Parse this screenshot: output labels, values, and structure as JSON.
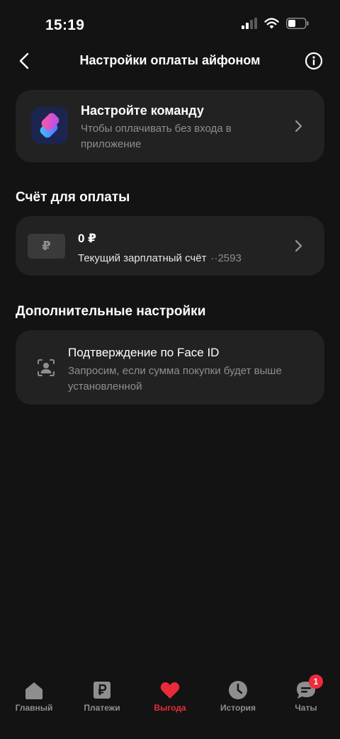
{
  "status_bar": {
    "time": "15:19"
  },
  "header": {
    "title": "Настройки оплаты айфоном"
  },
  "shortcut_card": {
    "title": "Настройте команду",
    "description": "Чтобы оплачивать без входа в приложение"
  },
  "account_section": {
    "title": "Счёт для оплаты",
    "balance": "0 ₽",
    "account_name": "Текущий зарплатный счёт",
    "account_number": "··2593",
    "badge_symbol": "₽"
  },
  "extra_section": {
    "title": "Дополнительные настройки",
    "faceid_title": "Подтверждение по Face ID",
    "faceid_description": "Запросим, если сумма покупки будет выше установленной"
  },
  "tab_bar": {
    "tabs": [
      {
        "label": "Главный",
        "icon": "home-icon"
      },
      {
        "label": "Платежи",
        "icon": "ruble-icon"
      },
      {
        "label": "Выгода",
        "icon": "heart-icon",
        "active": true
      },
      {
        "label": "История",
        "icon": "clock-icon"
      },
      {
        "label": "Чаты",
        "icon": "chat-icon",
        "badge": "1"
      }
    ]
  },
  "colors": {
    "background": "#131313",
    "card": "#222222",
    "accent": "#ea2c3a",
    "muted_text": "#8e8e8e"
  }
}
